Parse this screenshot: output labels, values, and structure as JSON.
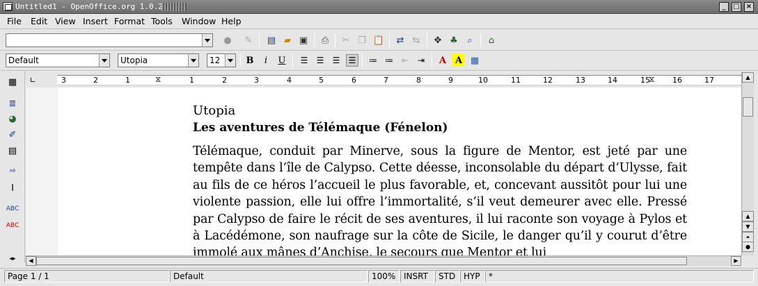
{
  "window": {
    "title": "Untitled1 - OpenOffice.org 1.0.2"
  },
  "menubar": {
    "items": [
      "File",
      "Edit",
      "View",
      "Insert",
      "Format",
      "Tools",
      "Window",
      "Help"
    ]
  },
  "toolbar": {
    "url_value": ""
  },
  "formatting": {
    "style": "Default",
    "font": "Utopia",
    "size": "12",
    "bold_label": "B",
    "italic_label": "i",
    "underline_label": "U",
    "font_color_label": "A",
    "highlight_label": "A"
  },
  "ruler": {
    "labels": [
      "3",
      "2",
      "1",
      "1",
      "2",
      "3",
      "4",
      "5",
      "6",
      "7",
      "8",
      "9",
      "10",
      "11",
      "12",
      "13",
      "14",
      "15",
      "16",
      "17"
    ]
  },
  "document": {
    "title": "Utopia",
    "subtitle": "Les aventures de Télémaque (Fénelon)",
    "body": "Télémaque, conduit par Minerve, sous la figure de Mentor, est jeté par une tempête dans l’île de Calypso. Cette déesse, inconsolable du départ d’Ulysse, fait au fils de ce héros l’accueil le plus favorable, et, concevant aussitôt pour lui une violente passion, elle lui offre l’immortalité, s’il veut demeurer avec elle. Pressé par Calypso de faire le récit de ses aventures, il lui raconte son voyage à Pylos et à Lacédémone, son naufrage sur la côte de Sicile, le danger qu’il y courut d’être immolé aux mânes d’Anchise, le secours que Mentor et lui"
  },
  "status": {
    "page": "Page 1 / 1",
    "style": "Default",
    "zoom": "100%",
    "insert_mode": "INSRT",
    "selection_mode": "STD",
    "hyperlink_mode": "HYP",
    "modified": "*"
  }
}
